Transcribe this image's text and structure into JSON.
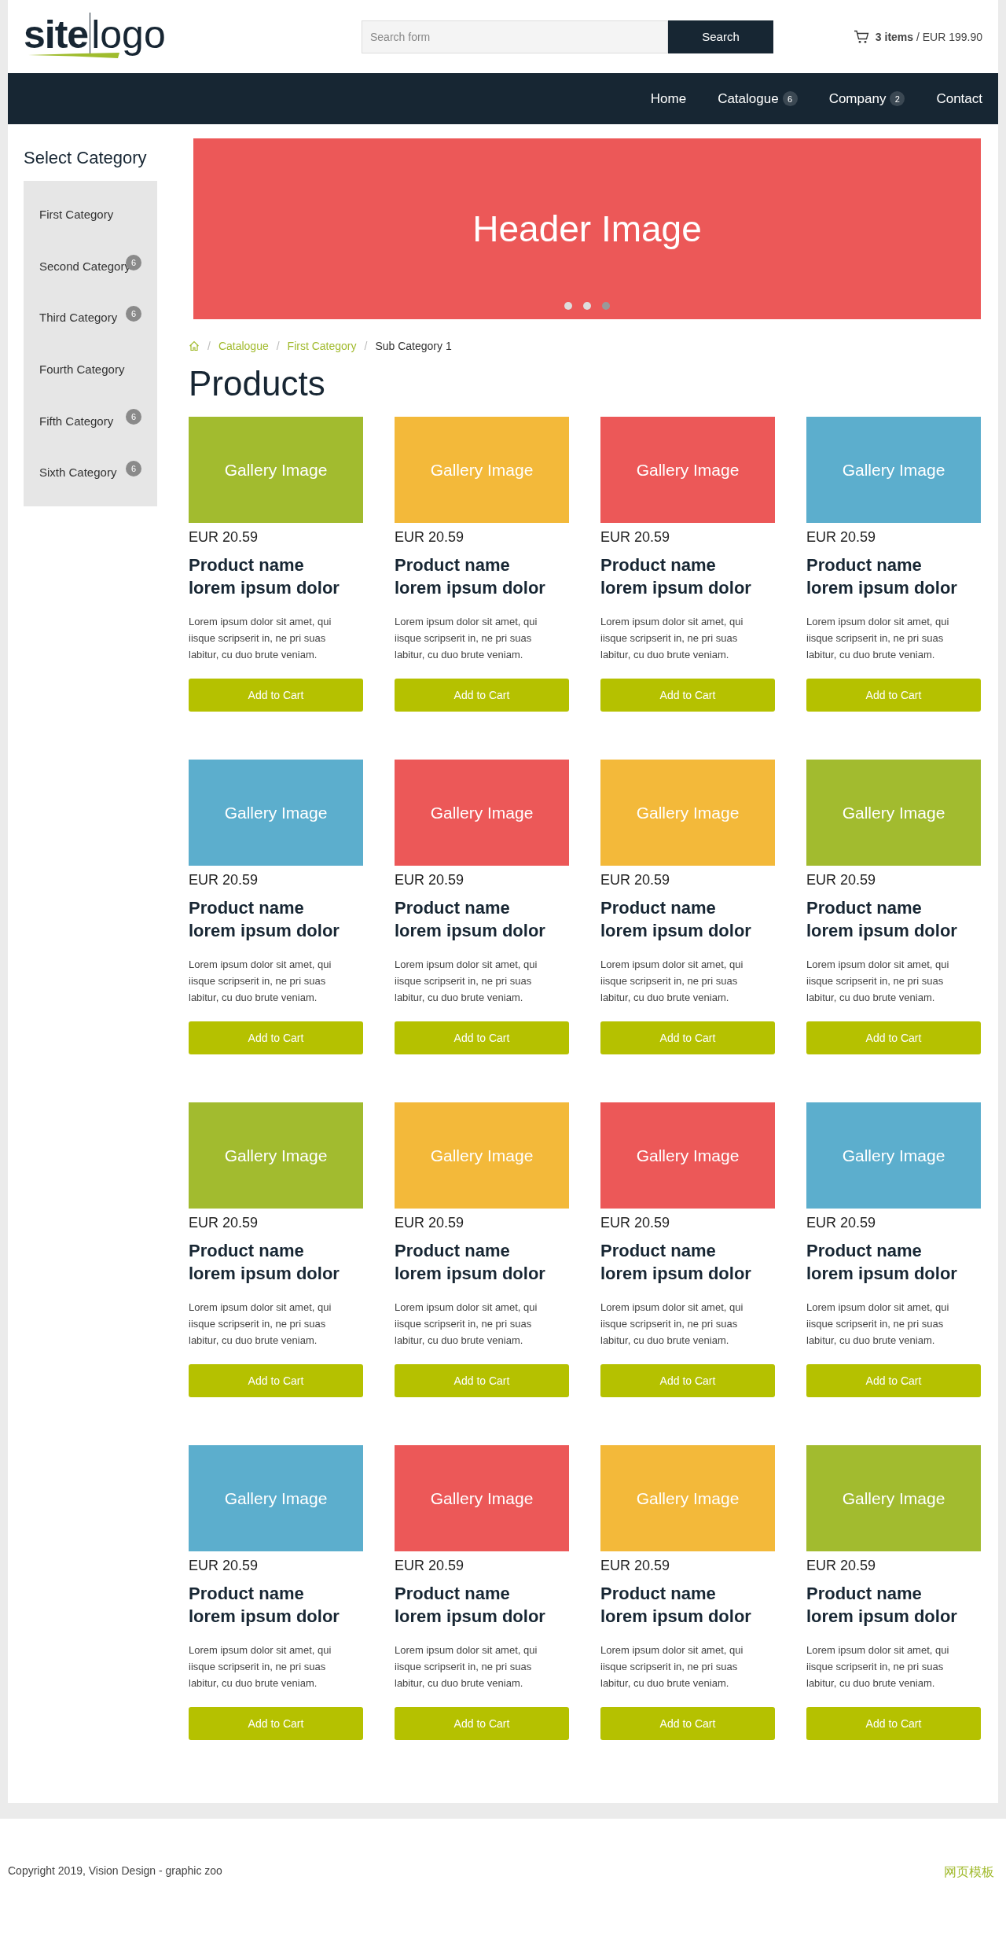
{
  "logo": {
    "bold": "site",
    "light": "logo"
  },
  "search": {
    "placeholder": "Search form",
    "button": "Search"
  },
  "cart": "**3 items** / EUR 199.90",
  "nav": [
    {
      "label": "Home"
    },
    {
      "label": "Catalogue",
      "badge": "6"
    },
    {
      "label": "Company",
      "badge": "2"
    },
    {
      "label": "Contact"
    }
  ],
  "sidebar": {
    "title": "Select Category",
    "items": [
      {
        "label": "First Category"
      },
      {
        "label": "Second Category",
        "badge": "6"
      },
      {
        "label": "Third Category",
        "badge": "6"
      },
      {
        "label": "Fourth Category"
      },
      {
        "label": "Fifth Category",
        "badge": "6"
      },
      {
        "label": "Sixth Category",
        "badge": "6"
      }
    ]
  },
  "banner": {
    "title": "Header Image",
    "dots": [
      {
        "selected": false
      },
      {
        "selected": false
      },
      {
        "selected": true
      }
    ]
  },
  "breadcrumb": {
    "separator": "/",
    "items": [
      {
        "label": "Catalogue",
        "current": false
      },
      {
        "label": "First Category",
        "current": false
      },
      {
        "label": "Sub Category 1",
        "current": true
      }
    ]
  },
  "heading": "Products",
  "products": [
    {
      "image": "Gallery Image",
      "color": "#a2bb2f",
      "price": "EUR 20.59",
      "name": "Product name lorem ipsum dolor",
      "description": "Lorem ipsum dolor sit amet, qui iisque scripserit in, ne pri suas labitur, cu duo brute veniam.",
      "button": "Add to Cart"
    },
    {
      "image": "Gallery Image",
      "color": "#f3b93a",
      "price": "EUR 20.59",
      "name": "Product name lorem ipsum dolor",
      "description": "Lorem ipsum dolor sit amet, qui iisque scripserit in, ne pri suas labitur, cu duo brute veniam.",
      "button": "Add to Cart"
    },
    {
      "image": "Gallery Image",
      "color": "#ec5858",
      "price": "EUR 20.59",
      "name": "Product name lorem ipsum dolor",
      "description": "Lorem ipsum dolor sit amet, qui iisque scripserit in, ne pri suas labitur, cu duo brute veniam.",
      "button": "Add to Cart"
    },
    {
      "image": "Gallery Image",
      "color": "#5caecd",
      "price": "EUR 20.59",
      "name": "Product name lorem ipsum dolor",
      "description": "Lorem ipsum dolor sit amet, qui iisque scripserit in, ne pri suas labitur, cu duo brute veniam.",
      "button": "Add to Cart"
    },
    {
      "image": "Gallery Image",
      "color": "#5caecd",
      "price": "EUR 20.59",
      "name": "Product name lorem ipsum dolor",
      "description": "Lorem ipsum dolor sit amet, qui iisque scripserit in, ne pri suas labitur, cu duo brute veniam.",
      "button": "Add to Cart"
    },
    {
      "image": "Gallery Image",
      "color": "#ec5858",
      "price": "EUR 20.59",
      "name": "Product name lorem ipsum dolor",
      "description": "Lorem ipsum dolor sit amet, qui iisque scripserit in, ne pri suas labitur, cu duo brute veniam.",
      "button": "Add to Cart"
    },
    {
      "image": "Gallery Image",
      "color": "#f3b93a",
      "price": "EUR 20.59",
      "name": "Product name lorem ipsum dolor",
      "description": "Lorem ipsum dolor sit amet, qui iisque scripserit in, ne pri suas labitur, cu duo brute veniam.",
      "button": "Add to Cart"
    },
    {
      "image": "Gallery Image",
      "color": "#a2bb2f",
      "price": "EUR 20.59",
      "name": "Product name lorem ipsum dolor",
      "description": "Lorem ipsum dolor sit amet, qui iisque scripserit in, ne pri suas labitur, cu duo brute veniam.",
      "button": "Add to Cart"
    },
    {
      "image": "Gallery Image",
      "color": "#a2bb2f",
      "price": "EUR 20.59",
      "name": "Product name lorem ipsum dolor",
      "description": "Lorem ipsum dolor sit amet, qui iisque scripserit in, ne pri suas labitur, cu duo brute veniam.",
      "button": "Add to Cart"
    },
    {
      "image": "Gallery Image",
      "color": "#f3b93a",
      "price": "EUR 20.59",
      "name": "Product name lorem ipsum dolor",
      "description": "Lorem ipsum dolor sit amet, qui iisque scripserit in, ne pri suas labitur, cu duo brute veniam.",
      "button": "Add to Cart"
    },
    {
      "image": "Gallery Image",
      "color": "#ec5858",
      "price": "EUR 20.59",
      "name": "Product name lorem ipsum dolor",
      "description": "Lorem ipsum dolor sit amet, qui iisque scripserit in, ne pri suas labitur, cu duo brute veniam.",
      "button": "Add to Cart"
    },
    {
      "image": "Gallery Image",
      "color": "#5caecd",
      "price": "EUR 20.59",
      "name": "Product name lorem ipsum dolor",
      "description": "Lorem ipsum dolor sit amet, qui iisque scripserit in, ne pri suas labitur, cu duo brute veniam.",
      "button": "Add to Cart"
    },
    {
      "image": "Gallery Image",
      "color": "#5caecd",
      "price": "EUR 20.59",
      "name": "Product name lorem ipsum dolor",
      "description": "Lorem ipsum dolor sit amet, qui iisque scripserit in, ne pri suas labitur, cu duo brute veniam.",
      "button": "Add to Cart"
    },
    {
      "image": "Gallery Image",
      "color": "#ec5858",
      "price": "EUR 20.59",
      "name": "Product name lorem ipsum dolor",
      "description": "Lorem ipsum dolor sit amet, qui iisque scripserit in, ne pri suas labitur, cu duo brute veniam.",
      "button": "Add to Cart"
    },
    {
      "image": "Gallery Image",
      "color": "#f3b93a",
      "price": "EUR 20.59",
      "name": "Product name lorem ipsum dolor",
      "description": "Lorem ipsum dolor sit amet, qui iisque scripserit in, ne pri suas labitur, cu duo brute veniam.",
      "button": "Add to Cart"
    },
    {
      "image": "Gallery Image",
      "color": "#a2bb2f",
      "price": "EUR 20.59",
      "name": "Product name lorem ipsum dolor",
      "description": "Lorem ipsum dolor sit amet, qui iisque scripserit in, ne pri suas labitur, cu duo brute veniam.",
      "button": "Add to Cart"
    }
  ],
  "footer": {
    "copyright": "Copyright 2019, Vision Design - graphic zoo",
    "link": "网页模板"
  }
}
